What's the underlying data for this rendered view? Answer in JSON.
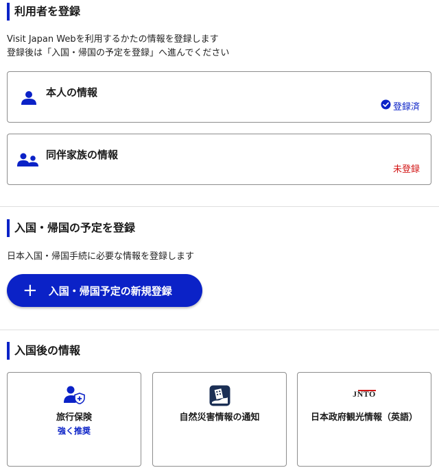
{
  "registrants": {
    "title": "利用者を登録",
    "desc_line1": "Visit Japan Webを利用するかたの情報を登録します",
    "desc_line2": "登録後は「入国・帰国の予定を登録」へ進んでください",
    "self_card": {
      "title": "本人の情報",
      "status": "登録済"
    },
    "companion_card": {
      "title": "同伴家族の情報",
      "status": "未登録"
    }
  },
  "schedule": {
    "title": "入国・帰国の予定を登録",
    "desc": "日本入国・帰国手続に必要な情報を登録します",
    "button_label": "入国・帰国予定の新規登録"
  },
  "after_entry": {
    "title": "入国後の情報",
    "tiles": [
      {
        "label": "旅行保険",
        "sub": "強く推奨",
        "icon": "person-shield-icon"
      },
      {
        "label": "自然災害情報の通知",
        "icon": "disaster-alert-icon"
      },
      {
        "label": "日本政府観光情報（英語）",
        "logo_text": "JNTO",
        "icon": "jnto-logo"
      }
    ]
  },
  "colors": {
    "accent": "#0b22c7",
    "registered": "#0b22c7",
    "unregistered": "#d21414",
    "border": "#8c8c8c",
    "divider": "#dedede"
  }
}
